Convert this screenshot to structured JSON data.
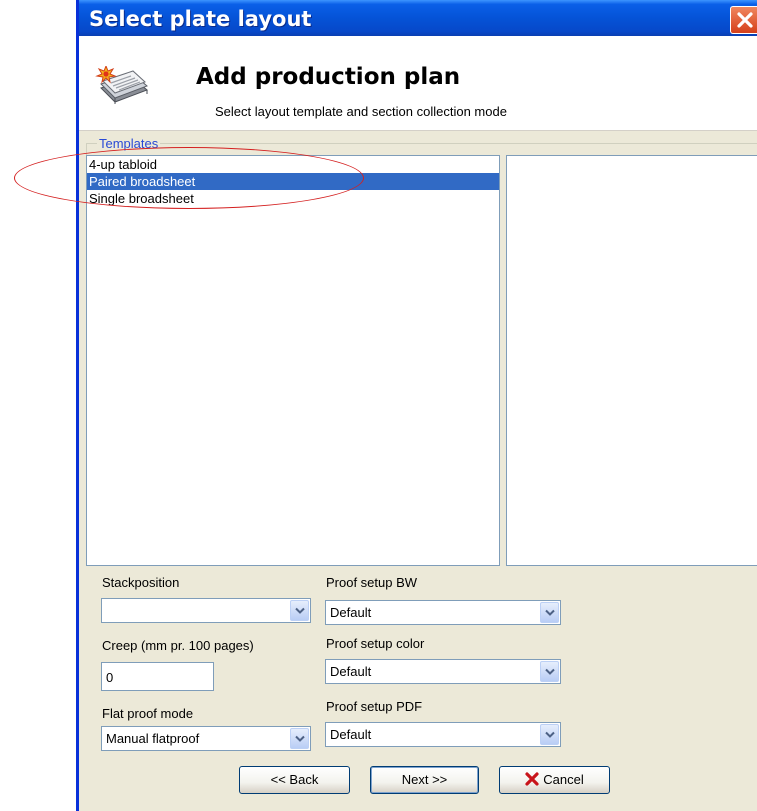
{
  "window": {
    "title": "Select plate layout"
  },
  "header": {
    "title": "Add production plan",
    "subtitle": "Select layout template and section collection mode",
    "icon": "newspaper-stack-icon"
  },
  "templates": {
    "group_label": "Templates",
    "items": [
      {
        "label": "4-up tabloid",
        "selected": false
      },
      {
        "label": "Paired broadsheet",
        "selected": true
      },
      {
        "label": "Single broadsheet",
        "selected": false
      }
    ]
  },
  "form": {
    "stackposition": {
      "label": "Stackposition",
      "value": ""
    },
    "creep": {
      "label": "Creep (mm pr. 100 pages)",
      "value": "0"
    },
    "flat_proof_mode": {
      "label": "Flat proof mode",
      "value": "Manual flatproof"
    },
    "proof_setup_bw": {
      "label": "Proof setup BW",
      "value": "Default"
    },
    "proof_setup_color": {
      "label": "Proof setup color",
      "value": "Default"
    },
    "proof_setup_pdf": {
      "label": "Proof setup PDF",
      "value": "Default"
    }
  },
  "buttons": {
    "back": "<< Back",
    "next": "Next >>",
    "cancel": "Cancel"
  },
  "colors": {
    "titlebar": "#0553d7",
    "selection": "#316ac5",
    "annotation": "#d42020",
    "group_label": "#2a4ad6"
  }
}
